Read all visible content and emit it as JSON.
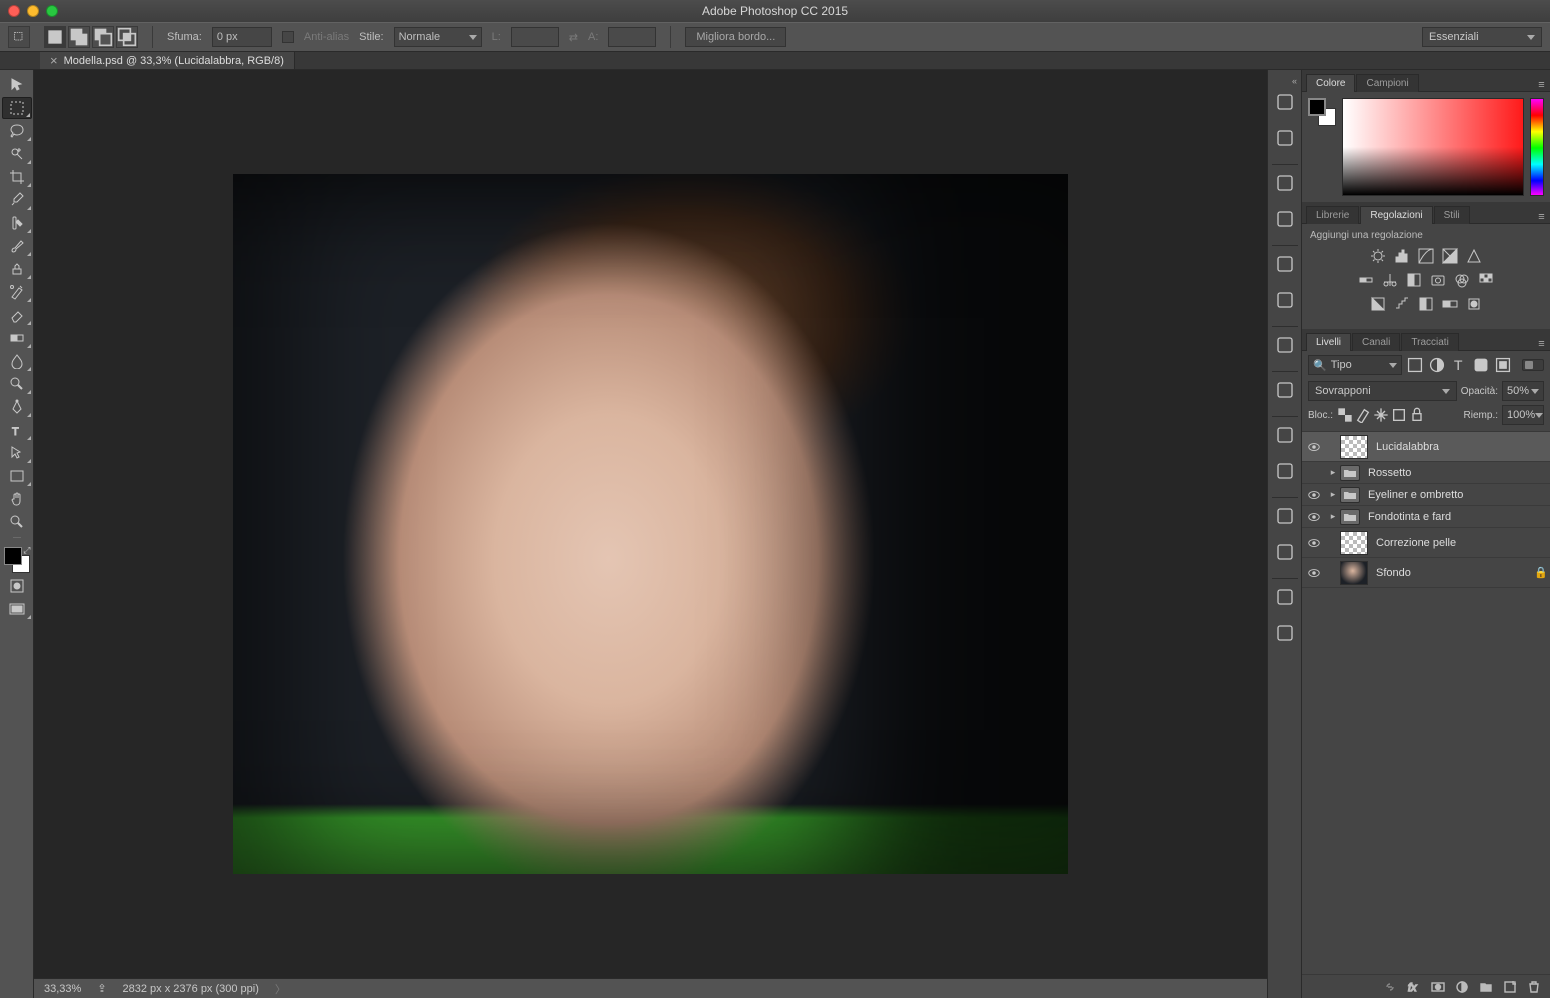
{
  "app": {
    "title": "Adobe Photoshop CC 2015"
  },
  "options_bar": {
    "feather_label": "Sfuma:",
    "feather_value": "0 px",
    "antialias_label": "Anti-alias",
    "style_label": "Stile:",
    "style_value": "Normale",
    "width_label": "L:",
    "height_label": "A:",
    "refine_edge": "Migliora bordo...",
    "workspace": "Essenziali"
  },
  "document": {
    "tab_title": "Modella.psd @ 33,3% (Lucidalabbra, RGB/8)",
    "zoom": "33,33%",
    "dimensions": "2832 px x 2376 px (300 ppi)"
  },
  "color_panel": {
    "tabs": [
      "Colore",
      "Campioni"
    ],
    "active": 0
  },
  "adjustments_panel": {
    "tabs": [
      "Librerie",
      "Regolazioni",
      "Stili"
    ],
    "active": 1,
    "hint": "Aggiungi una regolazione"
  },
  "layers_panel": {
    "tabs": [
      "Livelli",
      "Canali",
      "Tracciati"
    ],
    "active": 0,
    "filter_kind": "Tipo",
    "blend_mode": "Sovrapponi",
    "opacity_label": "Opacità:",
    "opacity_value": "50%",
    "lock_label": "Bloc.:",
    "fill_label": "Riemp.:",
    "fill_value": "100%",
    "layers": [
      {
        "name": "Lucidalabbra",
        "type": "pixel",
        "visible": true,
        "selected": true,
        "locked": false
      },
      {
        "name": "Rossetto",
        "type": "group",
        "visible": false,
        "selected": false,
        "locked": false
      },
      {
        "name": "Eyeliner e ombretto",
        "type": "group",
        "visible": true,
        "selected": false,
        "locked": false
      },
      {
        "name": "Fondotinta e fard",
        "type": "group",
        "visible": true,
        "selected": false,
        "locked": false
      },
      {
        "name": "Correzione pelle",
        "type": "pixel",
        "visible": true,
        "selected": false,
        "locked": false
      },
      {
        "name": "Sfondo",
        "type": "image",
        "visible": true,
        "selected": false,
        "locked": true
      }
    ]
  },
  "tools": [
    "move-tool",
    "marquee-tool",
    "lasso-tool",
    "quick-select-tool",
    "crop-tool",
    "eyedropper-tool",
    "healing-brush-tool",
    "brush-tool",
    "clone-stamp-tool",
    "history-brush-tool",
    "eraser-tool",
    "gradient-tool",
    "blur-tool",
    "dodge-tool",
    "pen-tool",
    "type-tool",
    "path-select-tool",
    "rectangle-tool",
    "hand-tool",
    "zoom-tool"
  ],
  "collapsed_panels": [
    "history-icon",
    "actions-icon",
    "sep",
    "brightness-icon",
    "histogram-icon",
    "sep",
    "clone-source-icon",
    "info-icon",
    "sep",
    "brush-presets-icon",
    "sep",
    "tool-presets-icon",
    "sep",
    "character-icon",
    "paragraph-icon",
    "sep",
    "glyphs-icon",
    "character-styles-icon",
    "sep",
    "notes-icon",
    "device-preview-icon"
  ]
}
